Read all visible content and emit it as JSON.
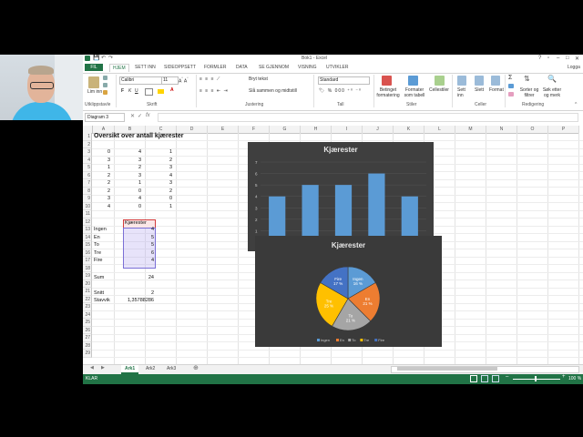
{
  "window": {
    "title": "Bok1 - Excel",
    "controls": [
      "?",
      "▫",
      "–",
      "□",
      "✕"
    ]
  },
  "ribbon_tabs": [
    "FIL",
    "HJEM",
    "SETT INN",
    "SIDEOPPSETT",
    "FORMLER",
    "DATA",
    "SE GJENNOM",
    "VISNING",
    "UTVIKLER"
  ],
  "account": "Logga",
  "ribbon": {
    "paste": "Lim inn",
    "clipboard": "Utklippstavle",
    "font_name": "Calibri",
    "font_size": "11",
    "font_group": "Skrift",
    "wrap_text": "Bryt tekst",
    "merge": "Slå sammen og midtstill",
    "alignment_group": "Justering",
    "number_format": "Standard",
    "number_group": "Tall",
    "cond_format": "Betinget formatering",
    "format_table": "Formater som tabell",
    "cell_styles": "Cellestiler",
    "styles_group": "Stiler",
    "insert": "Sett inn",
    "delete": "Slett",
    "format": "Format",
    "cells_group": "Celler",
    "sort": "Sorter og filtrer",
    "find": "Søk etter og merk",
    "editing_group": "Redigering"
  },
  "formula_bar": {
    "name_box": "Diagram 3",
    "fx": "fx",
    "value": ""
  },
  "columns": [
    "A",
    "B",
    "C",
    "D",
    "E",
    "F",
    "G",
    "H",
    "I",
    "J",
    "K",
    "L",
    "M",
    "N",
    "O",
    "P"
  ],
  "rows": [
    "1",
    "2",
    "3",
    "4",
    "5",
    "6",
    "7",
    "8",
    "9",
    "10",
    "11",
    "12",
    "13",
    "14",
    "15",
    "16",
    "17",
    "18",
    "19",
    "20",
    "21",
    "22",
    "23",
    "24",
    "25",
    "26",
    "27",
    "28",
    "29",
    "30"
  ],
  "sheet": {
    "title": "Oversikt over antall kjærester",
    "data_rows": [
      [
        "0",
        "4",
        "1"
      ],
      [
        "3",
        "3",
        "2"
      ],
      [
        "1",
        "2",
        "3"
      ],
      [
        "2",
        "3",
        "4"
      ],
      [
        "2",
        "1",
        "3"
      ],
      [
        "2",
        "0",
        "2"
      ],
      [
        "3",
        "4",
        "0"
      ],
      [
        "4",
        "0",
        "1"
      ]
    ],
    "table_header": "Kjærester",
    "table_rows": [
      {
        "label": "Ingen",
        "value": "4"
      },
      {
        "label": "En",
        "value": "5"
      },
      {
        "label": "To",
        "value": "5"
      },
      {
        "label": "Tre",
        "value": "6"
      },
      {
        "label": "Fire",
        "value": "4"
      }
    ],
    "sum_label": "Sum",
    "sum_value": "24",
    "mean_label": "Snitt",
    "mean_value": "2",
    "stdev_label": "Stavvik",
    "stdev_value": "1,35788286"
  },
  "chart_data": [
    {
      "type": "bar",
      "title": "Kjærester",
      "categories": [
        "Ingen",
        "En",
        "To",
        "Tre",
        "Fire"
      ],
      "values": [
        4,
        5,
        5,
        6,
        4
      ],
      "ylim": [
        0,
        7
      ],
      "y_ticks": [
        "0",
        "1",
        "2",
        "3",
        "4",
        "5",
        "6",
        "7"
      ],
      "color": "#5b9bd5",
      "background": "#3f3f3f",
      "grid": true
    },
    {
      "type": "pie",
      "title": "Kjærester",
      "categories": [
        "Ingen",
        "En",
        "To",
        "Tre",
        "Fire"
      ],
      "values": [
        4,
        5,
        5,
        6,
        4
      ],
      "labels": [
        "Ingen\n16 %",
        "En\n21 %",
        "To\n21 %",
        "Tre\n25 %",
        "Fire\n17 %"
      ],
      "colors": [
        "#5b9bd5",
        "#ed7d31",
        "#a5a5a5",
        "#ffc000",
        "#4472c4"
      ],
      "legend": "bottom",
      "background": "#3a3a3a"
    }
  ],
  "sheet_tabs": [
    "Ark1",
    "Ark2",
    "Ark3"
  ],
  "active_sheet": "Ark1",
  "status": {
    "mode": "KLAR",
    "zoom": "100 %"
  }
}
